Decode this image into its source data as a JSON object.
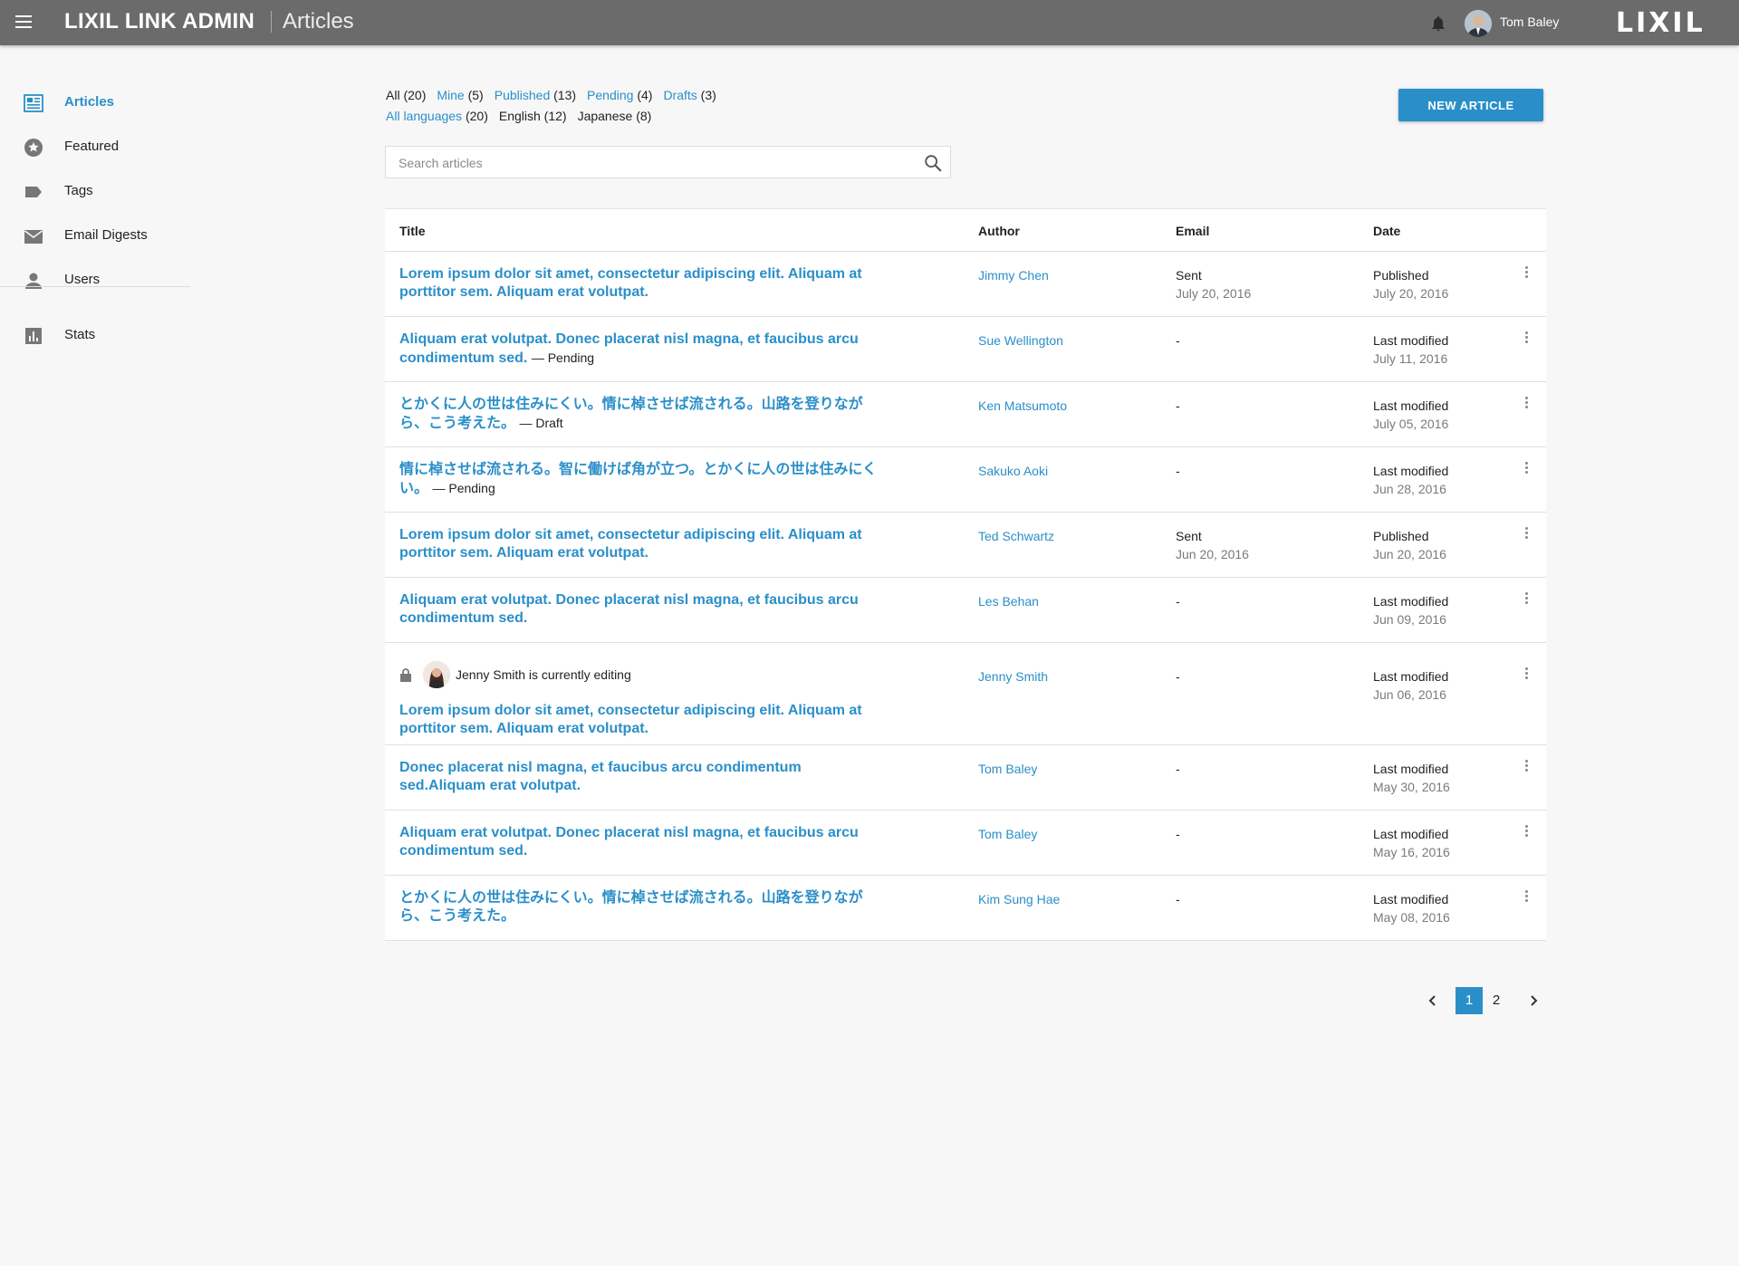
{
  "header": {
    "app_title": "LIXIL LINK ADMIN",
    "page_name": "Articles",
    "user_name": "Tom Baley",
    "brand": "LIXIL"
  },
  "sidebar": {
    "items": [
      {
        "label": "Articles",
        "icon": "articles-icon",
        "active": true
      },
      {
        "label": "Featured",
        "icon": "star-icon"
      },
      {
        "label": "Tags",
        "icon": "tag-icon"
      },
      {
        "label": "Email Digests",
        "icon": "email-icon"
      },
      {
        "label": "Users",
        "icon": "user-icon"
      },
      {
        "label": "Stats",
        "icon": "stats-icon"
      }
    ]
  },
  "filters": {
    "status": [
      {
        "label": "All",
        "count": "(20)",
        "link": false
      },
      {
        "label": "Mine",
        "count": "(5)",
        "link": true
      },
      {
        "label": "Published",
        "count": "(13)",
        "link": true
      },
      {
        "label": "Pending",
        "count": "(4)",
        "link": true
      },
      {
        "label": "Drafts",
        "count": "(3)",
        "link": true
      }
    ],
    "language": [
      {
        "label": "All languages",
        "count": "(20)",
        "link": true
      },
      {
        "label": "English",
        "count": "(12)",
        "link": false
      },
      {
        "label": "Japanese",
        "count": "(8)",
        "link": false
      }
    ]
  },
  "new_article_label": "NEW ARTICLE",
  "search": {
    "placeholder": "Search articles"
  },
  "table": {
    "columns": [
      "Title",
      "Author",
      "Email",
      "Date"
    ],
    "rows": [
      {
        "title": "Lorem ipsum dolor sit amet, consectetur adipiscing elit. Aliquam at porttitor sem.  Aliquam erat volutpat.",
        "note": "",
        "author": "Jimmy Chen",
        "email": "Sent",
        "email_date": "July 20, 2016",
        "date_label": "Published",
        "date": "July 20, 2016"
      },
      {
        "title": "Aliquam erat volutpat. Donec placerat nisl magna, et faucibus arcu condimentum sed.",
        "note": "— Pending",
        "author": "Sue Wellington",
        "email": "-",
        "email_date": "",
        "date_label": "Last modified",
        "date": "July 11, 2016"
      },
      {
        "title": "とかくに人の世は住みにくい。情に棹させば流される。山路を登りながら、こう考えた。",
        "note": "— Draft",
        "author": "Ken Matsumoto",
        "email": "-",
        "email_date": "",
        "date_label": "Last modified",
        "date": "July 05, 2016"
      },
      {
        "title": "情に棹させば流される。智に働けば角が立つ。とかくに人の世は住みにくい。",
        "note": "— Pending",
        "author": "Sakuko Aoki",
        "email": "-",
        "email_date": "",
        "date_label": "Last modified",
        "date": "Jun 28, 2016"
      },
      {
        "title": "Lorem ipsum dolor sit amet, consectetur adipiscing elit. Aliquam at porttitor sem.  Aliquam erat volutpat.",
        "note": "",
        "author": "Ted Schwartz",
        "email": "Sent",
        "email_date": "Jun 20, 2016",
        "date_label": "Published",
        "date": "Jun 20, 2016"
      },
      {
        "title": "Aliquam erat volutpat. Donec placerat nisl magna, et faucibus arcu condimentum sed.",
        "note": "",
        "author": "Les Behan",
        "email": "-",
        "email_date": "",
        "date_label": "Last modified",
        "date": "Jun 09, 2016"
      },
      {
        "title": "Lorem ipsum dolor sit amet, consectetur adipiscing elit. Aliquam at porttitor sem.  Aliquam erat volutpat.",
        "note": "",
        "author": "Jenny Smith",
        "email": "-",
        "email_date": "",
        "date_label": "Last modified",
        "date": "Jun 06, 2016",
        "editing": "Jenny Smith is currently editing"
      },
      {
        "title": "Donec placerat nisl magna, et faucibus arcu condimentum sed.Aliquam erat volutpat.",
        "note": "",
        "author": "Tom Baley",
        "email": "-",
        "email_date": "",
        "date_label": "Last modified",
        "date": "May 30, 2016"
      },
      {
        "title": "Aliquam erat volutpat. Donec placerat nisl magna, et faucibus arcu condimentum sed.",
        "note": "",
        "author": "Tom Baley",
        "email": "-",
        "email_date": "",
        "date_label": "Last modified",
        "date": "May 16, 2016"
      },
      {
        "title": "とかくに人の世は住みにくい。情に棹させば流される。山路を登りながら、こう考えた。",
        "note": "",
        "author": "Kim Sung Hae",
        "email": "-",
        "email_date": "",
        "date_label": "Last modified",
        "date": "May 08, 2016"
      }
    ]
  },
  "pagination": {
    "pages": [
      "1",
      "2"
    ],
    "current": "1"
  },
  "colors": {
    "accent": "#2a8fc9",
    "topbar": "#6b6b6b",
    "background": "#f7f7f7"
  }
}
